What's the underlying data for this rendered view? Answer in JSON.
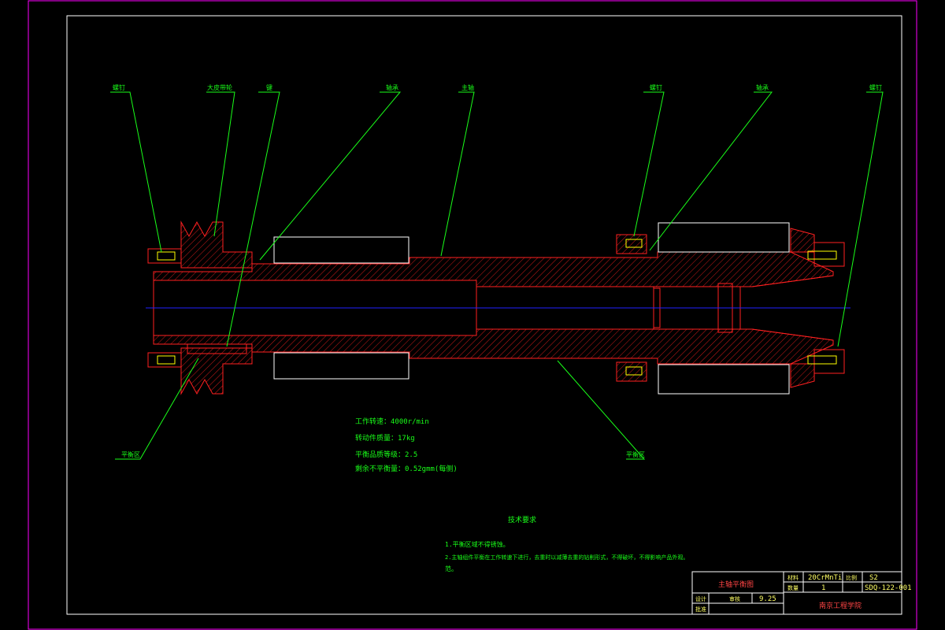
{
  "callouts": {
    "screw_top_left": "螺钉",
    "sleeve": "大皮带轮",
    "key": "键",
    "bearing_left": "轴承",
    "spindle": "主轴",
    "screw_top_right": "螺钉",
    "bearing_right": "轴承",
    "nut_right": "螺钉",
    "balance_left": "平衡区",
    "balance_right": "平衡区"
  },
  "specs": {
    "line1": "工作转速：4000r/min",
    "line2": "转动件质量：17kg",
    "line3": "平衡品质等级：2.5",
    "line4": "剩余不平衡量：0.52gmm(每侧)"
  },
  "requirements": {
    "title": "技术要求",
    "item1": "1.平衡区域不得锈蚀。",
    "item2": "2.主轴组件平衡在工作转速下进行，去重时以减薄去重的钻削形式，不得破坏，不得影响产品外观。",
    "item2_cont": "范。"
  },
  "title_block": {
    "name": "主轴平衡图",
    "material_label": "材料",
    "material": "20CrMnTi",
    "scale_label": "比例",
    "scale": "S2",
    "qty_label": "数量",
    "qty": "1",
    "drawing_no": "SDQ-122-001",
    "designer_label": "设计",
    "reviewer_label": "审核",
    "date": "9.25",
    "school": "南京工程学院",
    "approve_label": "批准"
  },
  "colors": {
    "border": "#ff00ff",
    "frame": "#ffffff",
    "part": "#ff2020",
    "leader": "#19ff19",
    "centerline": "#2020ff"
  }
}
